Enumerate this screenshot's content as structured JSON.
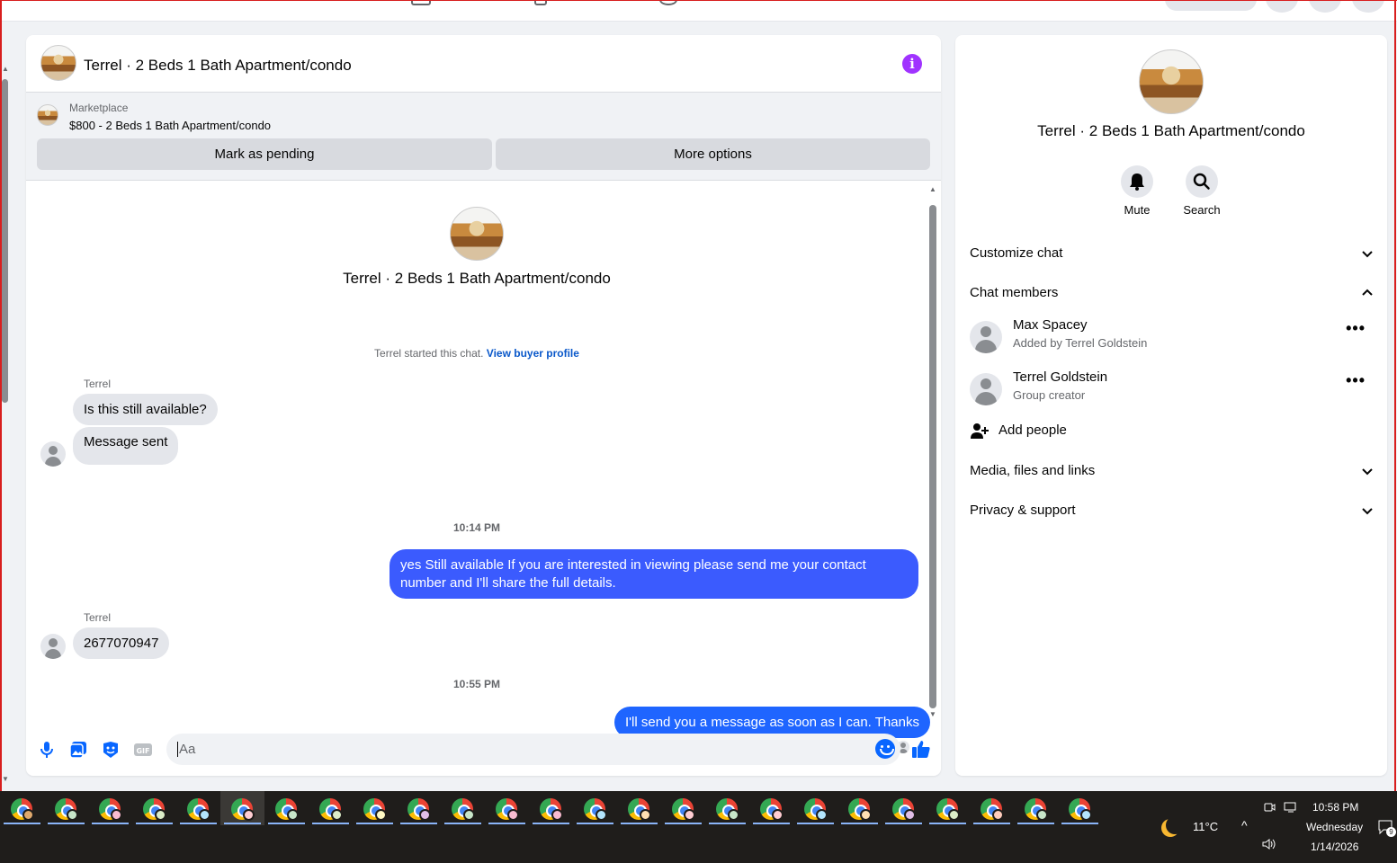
{
  "chat": {
    "title": "Terrel · 2 Beds 1 Bath Apartment/condo",
    "marketplace": {
      "label": "Marketplace",
      "item": "$800 - 2 Beds 1 Bath Apartment/condo",
      "pending_button": "Mark as pending",
      "options_button": "More options"
    },
    "intro_title": "Terrel · 2 Beds 1 Bath Apartment/condo",
    "started_text": "Terrel started this chat.",
    "buyer_profile_link": "View buyer profile",
    "messages": [
      {
        "sender": "Terrel",
        "text": "Is this still available?"
      },
      {
        "text": "Message sent"
      },
      {
        "timestamp": "10:14 PM"
      },
      {
        "text": "yes Still available If you are interested in viewing please send me your contact number and I'll share the full details."
      },
      {
        "sender": "Terrel",
        "text": "2677070947"
      },
      {
        "timestamp": "10:55 PM"
      },
      {
        "text": "I'll send you a message as soon as I can. Thanks"
      }
    ],
    "composer_placeholder": "Aa"
  },
  "details": {
    "title": "Terrel · 2 Beds 1 Bath Apartment/condo",
    "mute_label": "Mute",
    "search_label": "Search",
    "sections": {
      "customize": "Customize chat",
      "members": "Chat members",
      "media": "Media, files and links",
      "privacy": "Privacy & support"
    },
    "members": [
      {
        "name": "Max Spacey",
        "role": "Added by Terrel Goldstein"
      },
      {
        "name": "Terrel Goldstein",
        "role": "Group creator"
      }
    ],
    "add_people": "Add people"
  },
  "taskbar": {
    "weather": "11°C",
    "time": "10:58 PM",
    "day": "Wednesday",
    "date": "1/14/2026",
    "notification_count": "9"
  },
  "colors": {
    "outgoing_bubble": "#3b5bfe",
    "incoming_bubble": "#e4e6eb",
    "accent": "#0866ff",
    "info_icon": "#a033ff"
  }
}
